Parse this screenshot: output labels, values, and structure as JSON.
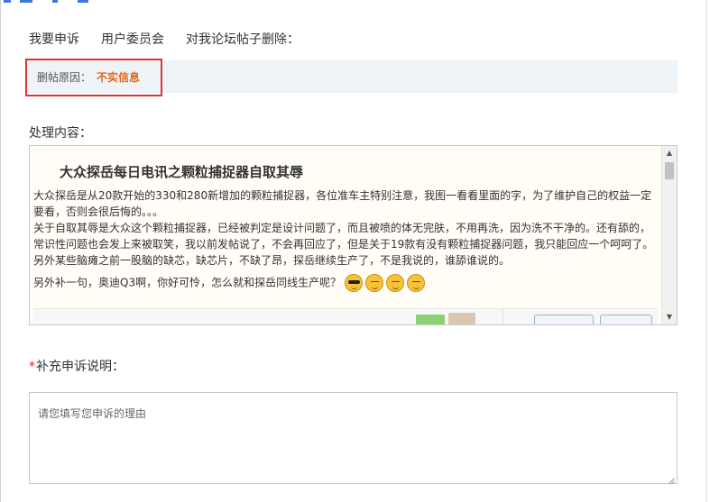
{
  "header": {
    "items": [
      "我要申诉",
      "用户委员会",
      "对我论坛帖子删除："
    ]
  },
  "reason": {
    "label": "删帖原因：",
    "value": "不实信息"
  },
  "processing": {
    "label": "处理内容："
  },
  "post": {
    "title": "大众探岳每日电讯之颗粒捕捉器自取其辱",
    "lines": [
      "大众探岳是从20款开始的330和280新增加的颗粒捕捉器，各位准车主特别注意，我图一看看里面的字，为了维护自己的权益一定要看，否则会很后悔的。。。",
      "关于自取其辱是大众这个颗粒捕捉器，已经被判定是设计问题了，而且被喷的体无完肤，不用再洗，因为洗不干净的。还有舔的，常识性问题也会发上来被取笑，我以前发帖说了，不会再回应了，但是关于19款有没有颗粒捕捉器问题，我只能回应一个呵呵了。另外某些脑瘫之前一股脑的缺芯，缺芯片，不缺了昂，探岳继续生产了，不是我说的，谁舔谁说的。",
      "另外补一句，奥迪Q3啊，你好可怜，怎么就和探岳同线生产呢？"
    ],
    "emojis": [
      "sunglasses-emoji",
      "smirk-emoji",
      "smirk-emoji",
      "smirk-emoji"
    ]
  },
  "supplement": {
    "required_mark": "*",
    "label": "补充申诉说明：",
    "placeholder": "请您填写您申诉的理由"
  },
  "colors": {
    "accent_blue": "#3c78d8",
    "highlight_red": "#d9363e",
    "reason_orange": "#e06a1a",
    "reason_bar_bg": "#eef3f8"
  }
}
